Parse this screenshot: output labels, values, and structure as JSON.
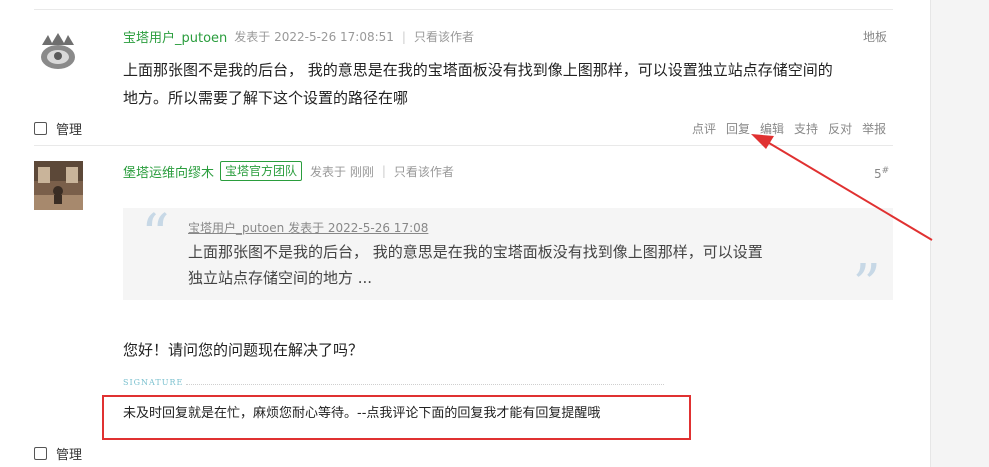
{
  "post1": {
    "author": "宝塔用户_putoen",
    "meta_posted": "发表于 2022-5-26 17:08:51",
    "meta_only_author": "只看该作者",
    "floor": "地板",
    "content_line1": "上面那张图不是我的后台，  我的意思是在我的宝塔面板没有找到像上图那样，可以设置独立站点存储空间的",
    "content_line2": "地方。所以需要了解下这个设置的路径在哪",
    "manage_label": "管理",
    "actions": [
      "点评",
      "回复",
      "编辑",
      "支持",
      "反对",
      "举报"
    ]
  },
  "post2": {
    "author": "堡塔运维向缪木",
    "badge": "宝塔官方团队",
    "meta_posted": "发表于 刚刚",
    "meta_only_author": "只看该作者",
    "floor_number": "5",
    "floor_mark": "#",
    "quote": {
      "head": "宝塔用户_putoen 发表于 2022-5-26 17:08",
      "line1": "上面那张图不是我的后台，  我的意思是在我的宝塔面板没有找到像上图那样，可以设置",
      "line2": "独立站点存储空间的地方 ..."
    },
    "reply": "您好！请问您的问题现在解决了吗？",
    "signature_label": "SIGNATURE",
    "signature_text": "未及时回复就是在忙，麻烦您耐心等待。--点我评论下面的回复我才能有回复提醒哦",
    "manage_label": "管理"
  },
  "colors": {
    "author_green": "#2a9d3d",
    "annotation_red": "#e03131",
    "quote_bg": "#f5f5f5"
  }
}
